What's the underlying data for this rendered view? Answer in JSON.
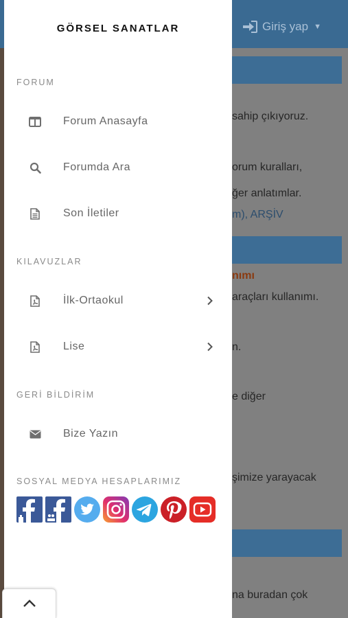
{
  "drawer": {
    "title": "GÖRSEL SANATLAR",
    "sections": [
      {
        "label": "FORUM",
        "items": [
          {
            "label": "Forum Anasayfa",
            "icon": "columns-icon"
          },
          {
            "label": "Forumda Ara",
            "icon": "search-icon"
          },
          {
            "label": "Son İletiler",
            "icon": "document-icon"
          }
        ]
      },
      {
        "label": "KILAVUZLAR",
        "items": [
          {
            "label": "İlk-Ortaokul",
            "icon": "pdf-file-icon",
            "has_submenu": true
          },
          {
            "label": "Lise",
            "icon": "pdf-file-icon",
            "has_submenu": true
          }
        ]
      },
      {
        "label": "GERİ BİLDİRİM",
        "items": [
          {
            "label": "Bize Yazın",
            "icon": "envelope-icon"
          }
        ]
      },
      {
        "label": "SOSYAL MEDYA HESAPLARIMIZ",
        "social": [
          "facebook-icon",
          "facebook-group-icon",
          "twitter-icon",
          "instagram-icon",
          "telegram-icon",
          "pinterest-icon",
          "youtube-icon"
        ]
      }
    ]
  },
  "background": {
    "login_label": "Giriş yap",
    "lines": [
      "sahip çıkıyoruz.",
      "orum kuralları,",
      "ğer anlatımlar.",
      "m), ARŞİV",
      "nımı",
      "araçları kullanımı.",
      "n.",
      "e diğer",
      "şimize yarayacak",
      "na buradan çok"
    ]
  },
  "colors": {
    "drawer_bg": "#ffffff",
    "topbar": "#3a6a92",
    "overlay": "#808080",
    "facebook": "#3b5998",
    "twitter": "#55acee",
    "telegram": "#2ca5e0",
    "pinterest": "#cb2027",
    "youtube": "#e52d27"
  }
}
